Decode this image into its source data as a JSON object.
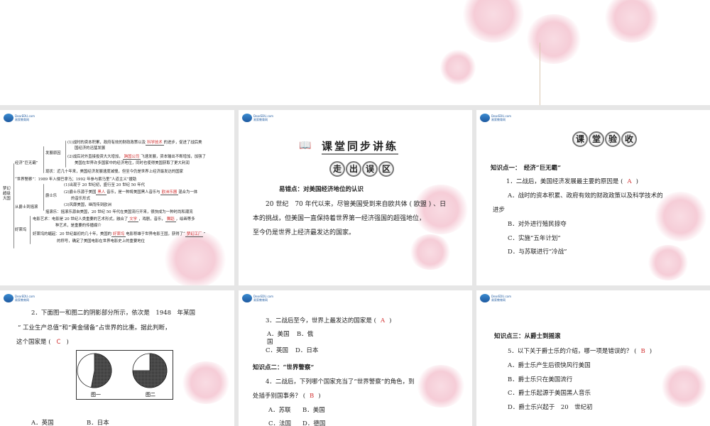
{
  "slide1": {
    "root": "梦幻超级大国",
    "b1": "经济“巨无霸”",
    "b1a": "发展原因",
    "l1a": "(1)战时的资本积累，政府有效的财政政策以及",
    "l1a_ans": "科学技术",
    "l1b": "的进步，促进了战后美",
    "l1c": "国经济的迅猛发展",
    "l2a": "(2)战后对外直接投资大大增加，",
    "l2a_ans": "跨国公司",
    "l2b": "飞速发展，资本输出不断增加，加强了",
    "l2c": "美国在世界许多国家中的经济地位，同时也使得美国获取了更大利润",
    "l3": "现状：近几十年来，美国经济发展速度减慢，但至今仍是世界上经济最发达的国家",
    "b2": "“世界警察”：1989 年入侵巴拿马；1992 年参与索马里“人道主义”援助",
    "b3": "从爵士到摇滚",
    "b3a": "爵士乐",
    "j1": "(1)出现于 20 世纪初，盛行至 20 世纪 50 年代",
    "j2a": "(2)爵士乐源于美国",
    "j2_ans1": "黑人",
    "j2b": "音乐，是一种将美国黑人音乐与",
    "j2_ans2": "欧洲乐器",
    "j2c": "混合为一体",
    "j2d": "的音乐形式",
    "j3": "(3)风靡美国，继而传到欧洲",
    "r1": "摇滚乐：摇滚乐源自美国，20 世纪 50 年代在美国流行开来，很快成为一种时尚和潮流",
    "b4": "好莱坞",
    "h1a": "电影艺术：电影是 20 世纪人类重要的艺术形式，融合了",
    "h1_ans1": "文学",
    "h1b": "，戏剧，音乐，",
    "h1_ans2": "舞蹈",
    "h1c": "，绘画等多",
    "h1d": "种艺术，是重要的传播媒介",
    "h2a": "好莱坞的崛起：20 世纪最初的几十年，美国的",
    "h2_ans1": "好莱坞",
    "h2b": "电影称雄于世界电影王国，获得了“",
    "h2_ans2": "梦幻工厂",
    "h2c": "”",
    "h2d": "的称号，确定了美国电影在世界电影史上的重要地位"
  },
  "logo": {
    "text": "DearEDU.com",
    "sub": "易家教育网"
  },
  "slide2": {
    "title": "课堂同步讲练",
    "badge": [
      "走",
      "出",
      "误",
      "区"
    ],
    "heading": "易错点：对美国经济地位的认识",
    "p1": "20 世纪　70 年代以来，尽管美国受到来自欧共体 ( 欧盟 ) 、日",
    "p2": "本的挑战，但美国一直保持着世界第一经济强国的超强地位，",
    "p3": "至今仍是世界上经济最发达的国家。"
  },
  "slide3": {
    "badge": [
      "课",
      "堂",
      "验",
      "收"
    ],
    "kp": "知识点一：　经济“巨无霸”",
    "q": "1．二战后，美国经济发展最主要的原因是 (",
    "ans": "A",
    "qe": ")",
    "a1": "A．战时的资本积累、政府有效的财政政策以及科学技术的",
    "a2": "进步",
    "b": "B．对外进行殖民掠夺",
    "c": "C．实施“五年计划”",
    "d": "D．与苏联进行“冷战”"
  },
  "slide4": {
    "q1": "2．下面图一和图二的阴影部分所示，依次是　1948　年某国",
    "q2": "“ 工业生产总值”和“黄金储备”占世界的比重。据此判断，",
    "q3": "这个国家是 (",
    "ans": "C",
    "qe": ")",
    "fig1": "图一",
    "fig2": "图二",
    "a": "A．英国",
    "b": "B．日本"
  },
  "slide5": {
    "q3": "3．二战后至今，世界上最发达的国家是 (",
    "ans3": "A",
    "qe": ")",
    "a": "A．美国",
    "b": "B．俄",
    "b2": "国",
    "c": "C．英国",
    "d": "D．日本",
    "kp": "知识点二：“世界警察”",
    "q4a": "4．二战后，下列哪个国家充当了“世界警察”的角色，到",
    "q4b": "处插手别国事务？ (",
    "ans4": "B",
    "a4": "A．苏联",
    "b4": "B．美国",
    "c4": "C．法国",
    "d4": "D．德国"
  },
  "slide6": {
    "kp": "知识点三：从爵士到摇滚",
    "q": "5．以下关于爵士乐的介绍，哪一项是错误的？ (",
    "ans": "B",
    "qe": ")",
    "a": "A．爵士乐产生后很快风行美国",
    "b": "B．爵士乐只在美国流行",
    "c": "C．爵士乐起源于美国黑人音乐",
    "d": "D．爵士乐兴起于　20　世纪初"
  },
  "chart_data": [
    {
      "type": "pie",
      "title": "图一",
      "values": [
        53,
        47
      ],
      "labels": [
        "shaded",
        "unshaded"
      ]
    },
    {
      "type": "pie",
      "title": "图二",
      "values": [
        75,
        25
      ],
      "labels": [
        "shaded",
        "unshaded"
      ]
    }
  ]
}
